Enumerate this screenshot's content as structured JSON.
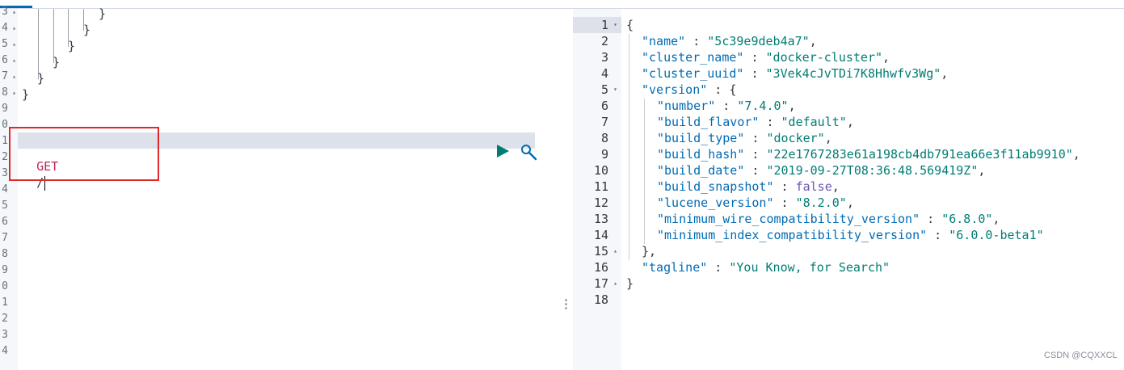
{
  "left_editor": {
    "gutter": [
      {
        "n": "3",
        "fold": "▴"
      },
      {
        "n": "4",
        "fold": "▴"
      },
      {
        "n": "5",
        "fold": "▴"
      },
      {
        "n": "6",
        "fold": "▴"
      },
      {
        "n": "7",
        "fold": "▴"
      },
      {
        "n": "8",
        "fold": "▴"
      },
      {
        "n": "9",
        "fold": ""
      },
      {
        "n": "0",
        "fold": ""
      },
      {
        "n": "1",
        "fold": ""
      },
      {
        "n": "2",
        "fold": ""
      },
      {
        "n": "3",
        "fold": ""
      },
      {
        "n": "4",
        "fold": ""
      },
      {
        "n": "5",
        "fold": ""
      },
      {
        "n": "6",
        "fold": ""
      },
      {
        "n": "7",
        "fold": ""
      },
      {
        "n": "8",
        "fold": ""
      },
      {
        "n": "9",
        "fold": ""
      },
      {
        "n": "0",
        "fold": ""
      },
      {
        "n": "1",
        "fold": ""
      },
      {
        "n": "2",
        "fold": ""
      },
      {
        "n": "3",
        "fold": ""
      },
      {
        "n": "4",
        "fold": ""
      }
    ],
    "lines": [
      "}",
      "}",
      "}",
      "}",
      "}",
      "}"
    ],
    "request": {
      "method": "GET",
      "path": "/"
    }
  },
  "output": {
    "lines": [
      {
        "n": "1",
        "fold": "▾",
        "parts": [
          {
            "t": "{",
            "c": "p"
          }
        ]
      },
      {
        "n": "2",
        "fold": "",
        "parts": [
          {
            "t": "\"name\"",
            "c": "k"
          },
          {
            "t": " : ",
            "c": "p"
          },
          {
            "t": "\"5c39e9deb4a7\"",
            "c": "s"
          },
          {
            "t": ",",
            "c": "p"
          }
        ]
      },
      {
        "n": "3",
        "fold": "",
        "parts": [
          {
            "t": "\"cluster_name\"",
            "c": "k"
          },
          {
            "t": " : ",
            "c": "p"
          },
          {
            "t": "\"docker-cluster\"",
            "c": "s"
          },
          {
            "t": ",",
            "c": "p"
          }
        ]
      },
      {
        "n": "4",
        "fold": "",
        "parts": [
          {
            "t": "\"cluster_uuid\"",
            "c": "k"
          },
          {
            "t": " : ",
            "c": "p"
          },
          {
            "t": "\"3Vek4cJvTDi7K8Hhwfv3Wg\"",
            "c": "s"
          },
          {
            "t": ",",
            "c": "p"
          }
        ]
      },
      {
        "n": "5",
        "fold": "▾",
        "parts": [
          {
            "t": "\"version\"",
            "c": "k"
          },
          {
            "t": " : {",
            "c": "p"
          }
        ]
      },
      {
        "n": "6",
        "fold": "",
        "parts": [
          {
            "t": "\"number\"",
            "c": "k"
          },
          {
            "t": " : ",
            "c": "p"
          },
          {
            "t": "\"7.4.0\"",
            "c": "s"
          },
          {
            "t": ",",
            "c": "p"
          }
        ]
      },
      {
        "n": "7",
        "fold": "",
        "parts": [
          {
            "t": "\"build_flavor\"",
            "c": "k"
          },
          {
            "t": " : ",
            "c": "p"
          },
          {
            "t": "\"default\"",
            "c": "s"
          },
          {
            "t": ",",
            "c": "p"
          }
        ]
      },
      {
        "n": "8",
        "fold": "",
        "parts": [
          {
            "t": "\"build_type\"",
            "c": "k"
          },
          {
            "t": " : ",
            "c": "p"
          },
          {
            "t": "\"docker\"",
            "c": "s"
          },
          {
            "t": ",",
            "c": "p"
          }
        ]
      },
      {
        "n": "9",
        "fold": "",
        "parts": [
          {
            "t": "\"build_hash\"",
            "c": "k"
          },
          {
            "t": " : ",
            "c": "p"
          },
          {
            "t": "\"22e1767283e61a198cb4db791ea66e3f11ab9910\"",
            "c": "s"
          },
          {
            "t": ",",
            "c": "p"
          }
        ]
      },
      {
        "n": "10",
        "fold": "",
        "parts": [
          {
            "t": "\"build_date\"",
            "c": "k"
          },
          {
            "t": " : ",
            "c": "p"
          },
          {
            "t": "\"2019-09-27T08:36:48.569419Z\"",
            "c": "s"
          },
          {
            "t": ",",
            "c": "p"
          }
        ]
      },
      {
        "n": "11",
        "fold": "",
        "parts": [
          {
            "t": "\"build_snapshot\"",
            "c": "k"
          },
          {
            "t": " : ",
            "c": "p"
          },
          {
            "t": "false",
            "c": "b"
          },
          {
            "t": ",",
            "c": "p"
          }
        ]
      },
      {
        "n": "12",
        "fold": "",
        "parts": [
          {
            "t": "\"lucene_version\"",
            "c": "k"
          },
          {
            "t": " : ",
            "c": "p"
          },
          {
            "t": "\"8.2.0\"",
            "c": "s"
          },
          {
            "t": ",",
            "c": "p"
          }
        ]
      },
      {
        "n": "13",
        "fold": "",
        "parts": [
          {
            "t": "\"minimum_wire_compatibility_version\"",
            "c": "k"
          },
          {
            "t": " : ",
            "c": "p"
          },
          {
            "t": "\"6.8.0\"",
            "c": "s"
          },
          {
            "t": ",",
            "c": "p"
          }
        ]
      },
      {
        "n": "14",
        "fold": "",
        "parts": [
          {
            "t": "\"minimum_index_compatibility_version\"",
            "c": "k"
          },
          {
            "t": " : ",
            "c": "p"
          },
          {
            "t": "\"6.0.0-beta1\"",
            "c": "s"
          }
        ]
      },
      {
        "n": "15",
        "fold": "▴",
        "parts": [
          {
            "t": "},",
            "c": "p"
          }
        ]
      },
      {
        "n": "16",
        "fold": "",
        "parts": [
          {
            "t": "\"tagline\"",
            "c": "k"
          },
          {
            "t": " : ",
            "c": "p"
          },
          {
            "t": "\"You Know, for Search\"",
            "c": "s"
          }
        ]
      },
      {
        "n": "17",
        "fold": "▴",
        "parts": [
          {
            "t": "}",
            "c": "p"
          }
        ]
      },
      {
        "n": "18",
        "fold": "",
        "parts": []
      }
    ]
  },
  "icons": {
    "run": "play-triangle-icon",
    "settings": "wrench-icon",
    "resize": "vertical-dots-icon"
  },
  "colors": {
    "accent": "#006bb4",
    "run": "#017d73",
    "method": "#bd2759",
    "string": "#017d73",
    "key": "#006bb4",
    "bool": "#6b55ae",
    "highlight_border": "#e0272a"
  },
  "watermark": "CSDN @CQXXCL"
}
